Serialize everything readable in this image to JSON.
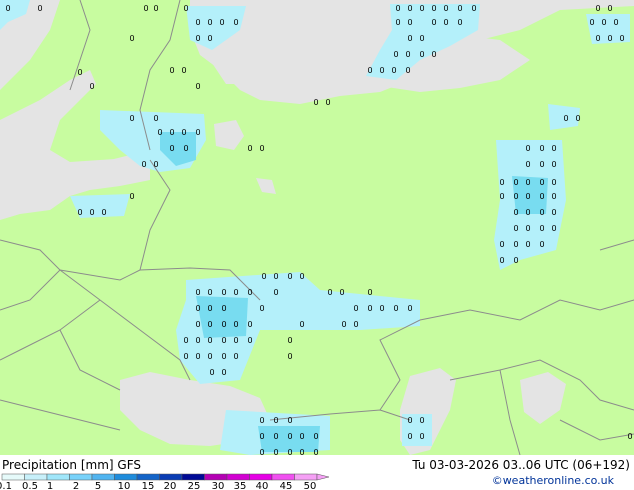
{
  "title": {
    "variable": "Precipitation [mm]",
    "model": "GFS",
    "datetime": "Tu 03-03-2026 03..06 UTC (06+192)"
  },
  "credit": "©weatheronline.co.uk",
  "colors": {
    "land": "#c8fca0",
    "sea": "#e4e4e4",
    "border": "#8c8c8c",
    "precip_light": "#b4f0fa",
    "precip_medium": "#78dcf0"
  },
  "scale": {
    "labels": [
      "0.1",
      "0.5",
      "1",
      "2",
      "5",
      "10",
      "15",
      "20",
      "25",
      "30",
      "35",
      "40",
      "45",
      "50"
    ],
    "colors": [
      "#e6fafa",
      "#c8f0fa",
      "#a0e6fa",
      "#78d2fa",
      "#50b4f0",
      "#1e8cdc",
      "#1464c8",
      "#0a3cb4",
      "#000a96",
      "#b400b4",
      "#d200d2",
      "#e600e6",
      "#f050f0",
      "#f5a0f5"
    ]
  },
  "markers": {
    "glyph": "0",
    "rows": [
      [
        [
          8,
          8
        ],
        [
          40,
          8
        ],
        [
          146,
          8
        ],
        [
          156,
          8
        ],
        [
          186,
          8
        ]
      ],
      [
        [
          398,
          8
        ],
        [
          410,
          8
        ],
        [
          422,
          8
        ],
        [
          434,
          8
        ],
        [
          446,
          8
        ],
        [
          460,
          8
        ],
        [
          474,
          8
        ],
        [
          598,
          8
        ],
        [
          610,
          8
        ]
      ],
      [
        [
          198,
          22
        ],
        [
          210,
          22
        ],
        [
          222,
          22
        ],
        [
          236,
          22
        ],
        [
          398,
          22
        ],
        [
          410,
          22
        ],
        [
          434,
          22
        ],
        [
          446,
          22
        ],
        [
          460,
          22
        ],
        [
          592,
          22
        ],
        [
          604,
          22
        ],
        [
          616,
          22
        ]
      ],
      [
        [
          132,
          38
        ],
        [
          198,
          38
        ],
        [
          210,
          38
        ],
        [
          410,
          38
        ],
        [
          422,
          38
        ],
        [
          598,
          38
        ],
        [
          610,
          38
        ],
        [
          622,
          38
        ]
      ],
      [
        [
          396,
          54
        ],
        [
          408,
          54
        ],
        [
          422,
          54
        ],
        [
          434,
          54
        ]
      ],
      [
        [
          172,
          70
        ],
        [
          184,
          70
        ],
        [
          370,
          70
        ],
        [
          382,
          70
        ],
        [
          394,
          70
        ],
        [
          408,
          70
        ]
      ],
      [
        [
          80,
          72
        ],
        [
          92,
          86
        ],
        [
          198,
          86
        ]
      ],
      [
        [
          316,
          102
        ],
        [
          328,
          102
        ]
      ],
      [
        [
          132,
          118
        ],
        [
          156,
          118
        ],
        [
          566,
          118
        ],
        [
          578,
          118
        ]
      ],
      [
        [
          160,
          132
        ],
        [
          172,
          132
        ],
        [
          184,
          132
        ],
        [
          198,
          132
        ]
      ],
      [
        [
          172,
          148
        ],
        [
          186,
          148
        ],
        [
          250,
          148
        ],
        [
          262,
          148
        ],
        [
          528,
          148
        ],
        [
          542,
          148
        ],
        [
          554,
          148
        ]
      ],
      [
        [
          144,
          164
        ],
        [
          156,
          164
        ],
        [
          528,
          164
        ],
        [
          542,
          164
        ],
        [
          554,
          164
        ]
      ],
      [
        [
          502,
          182
        ],
        [
          516,
          182
        ],
        [
          528,
          182
        ],
        [
          542,
          182
        ],
        [
          554,
          182
        ]
      ],
      [
        [
          132,
          196
        ],
        [
          502,
          196
        ],
        [
          516,
          196
        ],
        [
          528,
          196
        ],
        [
          542,
          196
        ],
        [
          554,
          196
        ]
      ],
      [
        [
          80,
          212
        ],
        [
          92,
          212
        ],
        [
          104,
          212
        ],
        [
          516,
          212
        ],
        [
          528,
          212
        ],
        [
          542,
          212
        ],
        [
          554,
          212
        ]
      ],
      [
        [
          516,
          228
        ],
        [
          528,
          228
        ],
        [
          542,
          228
        ],
        [
          554,
          228
        ]
      ],
      [
        [
          502,
          244
        ],
        [
          516,
          244
        ],
        [
          528,
          244
        ],
        [
          542,
          244
        ]
      ],
      [
        [
          502,
          260
        ],
        [
          516,
          260
        ]
      ],
      [
        [
          264,
          276
        ],
        [
          276,
          276
        ],
        [
          290,
          276
        ],
        [
          302,
          276
        ]
      ],
      [
        [
          198,
          292
        ],
        [
          210,
          292
        ],
        [
          224,
          292
        ],
        [
          236,
          292
        ],
        [
          250,
          292
        ],
        [
          276,
          292
        ],
        [
          330,
          292
        ],
        [
          342,
          292
        ],
        [
          370,
          292
        ]
      ],
      [
        [
          198,
          308
        ],
        [
          210,
          308
        ],
        [
          224,
          308
        ],
        [
          262,
          308
        ],
        [
          356,
          308
        ],
        [
          370,
          308
        ],
        [
          382,
          308
        ],
        [
          396,
          308
        ],
        [
          410,
          308
        ]
      ],
      [
        [
          198,
          324
        ],
        [
          210,
          324
        ],
        [
          224,
          324
        ],
        [
          236,
          324
        ],
        [
          250,
          324
        ],
        [
          302,
          324
        ],
        [
          344,
          324
        ],
        [
          356,
          324
        ]
      ],
      [
        [
          186,
          340
        ],
        [
          198,
          340
        ],
        [
          210,
          340
        ],
        [
          224,
          340
        ],
        [
          236,
          340
        ],
        [
          250,
          340
        ],
        [
          290,
          340
        ]
      ],
      [
        [
          186,
          356
        ],
        [
          198,
          356
        ],
        [
          210,
          356
        ],
        [
          224,
          356
        ],
        [
          236,
          356
        ],
        [
          290,
          356
        ]
      ],
      [
        [
          212,
          372
        ],
        [
          224,
          372
        ]
      ],
      [
        [
          262,
          420
        ],
        [
          276,
          420
        ],
        [
          290,
          420
        ],
        [
          410,
          420
        ],
        [
          422,
          420
        ]
      ],
      [
        [
          262,
          436
        ],
        [
          276,
          436
        ],
        [
          290,
          436
        ],
        [
          302,
          436
        ],
        [
          316,
          436
        ],
        [
          410,
          436
        ],
        [
          422,
          436
        ],
        [
          630,
          436
        ]
      ],
      [
        [
          262,
          452
        ],
        [
          276,
          452
        ],
        [
          290,
          452
        ],
        [
          302,
          452
        ],
        [
          316,
          452
        ]
      ]
    ]
  }
}
